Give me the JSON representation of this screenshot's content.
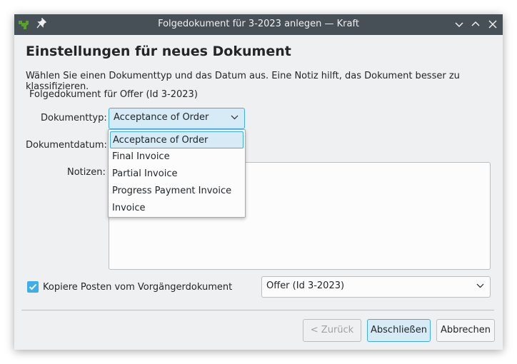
{
  "window": {
    "title": "Folgedokument für 3-2023 anlegen — Kraft"
  },
  "dialog": {
    "heading": "Einstellungen für neues Dokument",
    "description": "Wählen Sie einen Dokumenttyp und das Datum aus. Eine Notiz hilft, das Dokument besser zu klassifizieren.",
    "subtitle": "Folgedokument für Offer (Id 3-2023)"
  },
  "form": {
    "doctype_label": "Dokumenttyp:",
    "doctype_value": "Acceptance of Order",
    "date_label": "Dokumentdatum:",
    "notes_label": "Notizen:",
    "doctype_options": [
      "Acceptance of Order",
      "Final Invoice",
      "Partial Invoice",
      "Progress Payment Invoice",
      "Invoice"
    ],
    "copy_label": "Kopiere Posten vom Vorgängerdokument",
    "copy_checked": true,
    "source_value": "Offer (Id 3-2023)"
  },
  "buttons": {
    "back": "< Zurück",
    "finish": "Abschließen",
    "cancel": "Abbrechen"
  },
  "colors": {
    "accent": "#3daee9",
    "titlebar": "#475057",
    "app_icon": "#5aa02c"
  },
  "icons": {
    "app": "kraft-app-icon",
    "pin": "pin-icon",
    "minimize": "chevron-down-icon",
    "maximize": "chevron-up-icon",
    "close": "close-icon"
  }
}
